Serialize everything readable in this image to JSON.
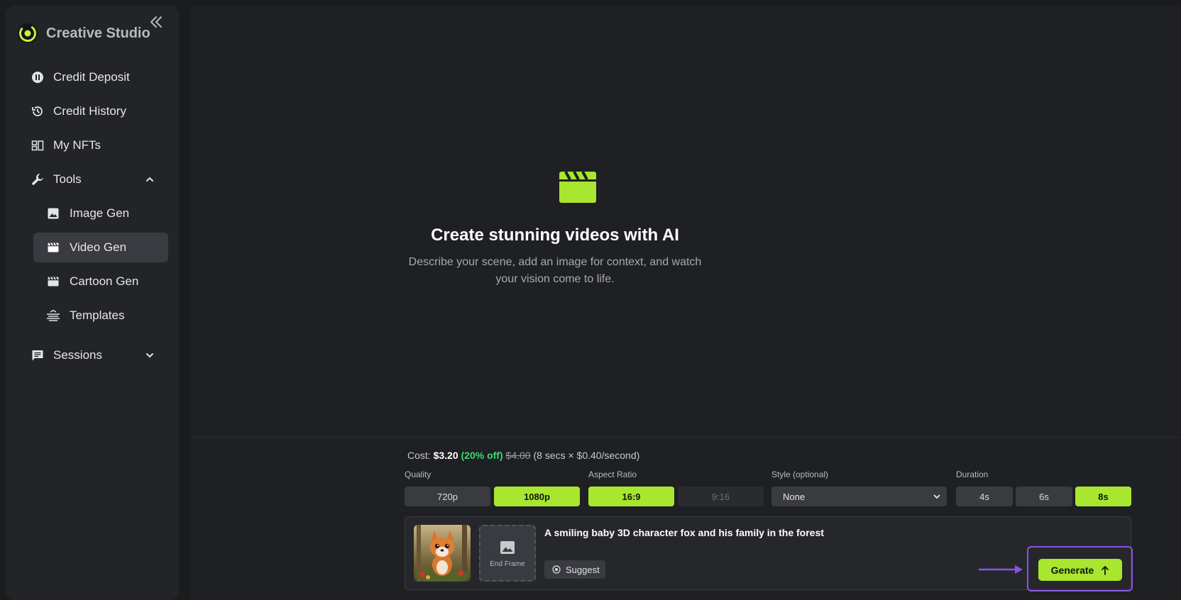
{
  "brand": {
    "name": "Creative Studio",
    "logo_icon": "brand-logo-icon",
    "accent": "#a8e62f"
  },
  "sidebar": {
    "collapse_icon": "double-chevron-left-icon",
    "items": [
      {
        "label": "Credit Deposit",
        "icon": "pause-circle-icon"
      },
      {
        "label": "Credit History",
        "icon": "history-icon"
      },
      {
        "label": "My NFTs",
        "icon": "grid-icon"
      },
      {
        "label": "Tools",
        "icon": "wrench-icon",
        "expanded": true
      },
      {
        "label": "Image Gen",
        "icon": "image-icon"
      },
      {
        "label": "Video Gen",
        "icon": "clapperboard-icon",
        "active": true
      },
      {
        "label": "Cartoon Gen",
        "icon": "clapperboard-icon"
      },
      {
        "label": "Templates",
        "icon": "templates-icon"
      },
      {
        "label": "Sessions",
        "icon": "chat-icon",
        "expanded": false
      }
    ]
  },
  "hero": {
    "icon": "clapperboard-icon",
    "title": "Create stunning videos with AI",
    "subtitle": "Describe your scene, add an image for context, and watch your vision come to life."
  },
  "cost": {
    "label": "Cost:",
    "price": "$3.20",
    "discount": "(20% off)",
    "original": "$4.00",
    "detail": "(8 secs × $0.40/second)"
  },
  "options": {
    "quality": {
      "label": "Quality",
      "options": [
        "720p",
        "1080p"
      ],
      "selected": "1080p"
    },
    "aspect_ratio": {
      "label": "Aspect Ratio",
      "options": [
        "16:9",
        "9:16"
      ],
      "selected": "16:9",
      "disabled": [
        "9:16"
      ]
    },
    "style": {
      "label": "Style (optional)",
      "value": "None"
    },
    "duration": {
      "label": "Duration",
      "options": [
        "4s",
        "6s",
        "8s"
      ],
      "selected": "8s"
    }
  },
  "composer": {
    "start_frame_icon": "fox-thumbnail-image",
    "end_frame_label": "End Frame",
    "prompt": "A smiling baby 3D character fox and his family in the forest",
    "suggest_label": "Suggest",
    "generate_label": "Generate"
  },
  "annotation_color": "#8a52ec"
}
